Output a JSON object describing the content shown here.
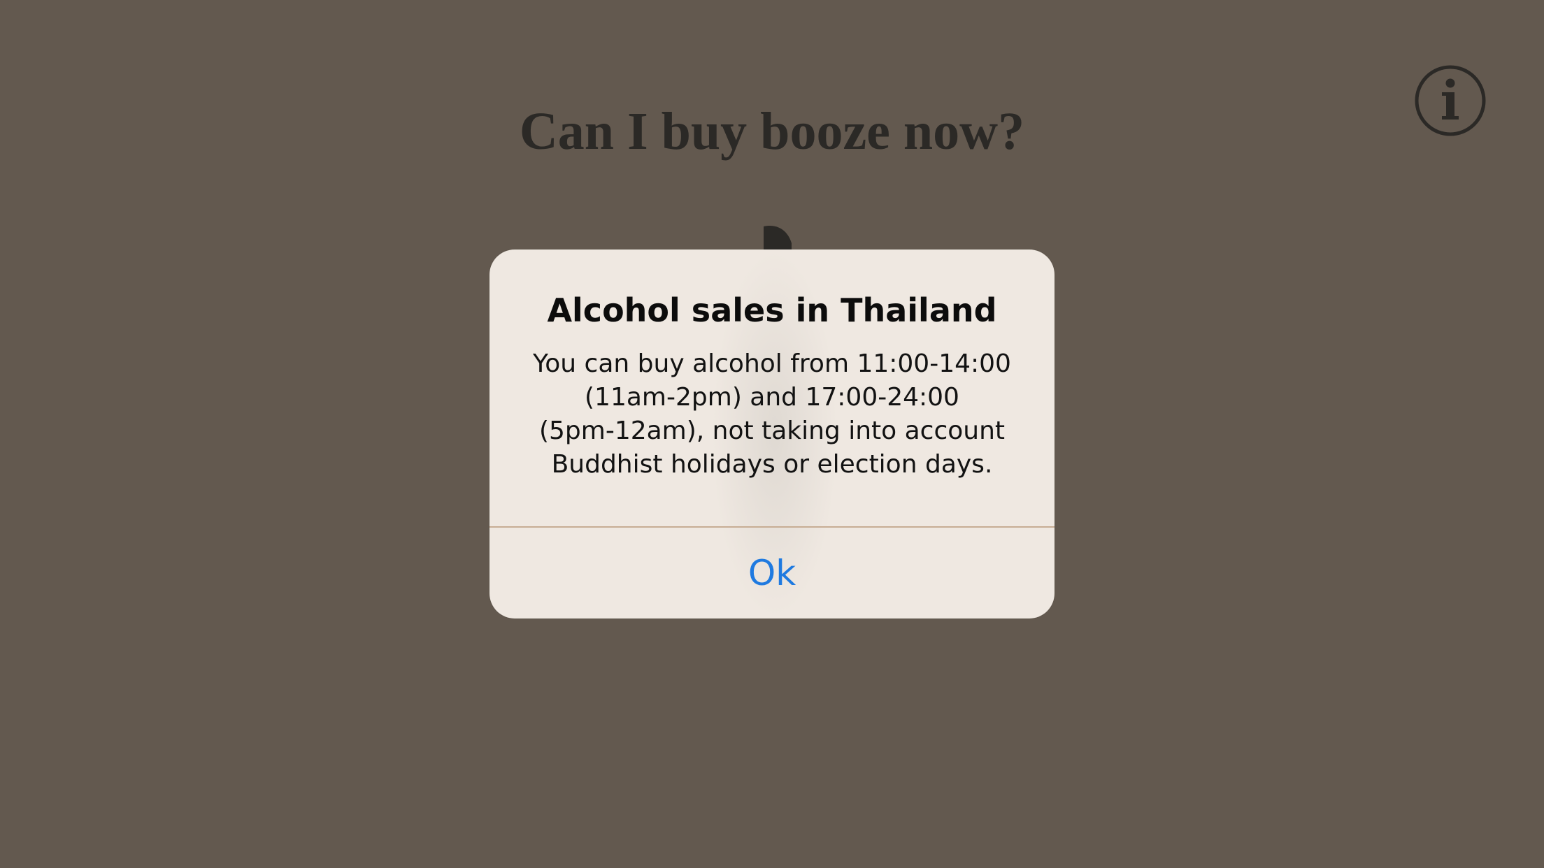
{
  "app": {
    "title": "Can I buy booze now?",
    "info_icon": "info-circle-icon"
  },
  "alert": {
    "title": "Alcohol sales in Thailand",
    "message_lines": [
      "You can buy alcohol from 11:00-14:00",
      "(11am-2pm) and 17:00-24:00",
      "(5pm-12am), not taking into account",
      "Buddhist holidays or election days."
    ],
    "button_label": "Ok"
  },
  "colors": {
    "background": "#63594f",
    "title_text": "#2b2926",
    "alert_background": "#efe8e1",
    "alert_divider": "#c7ad94",
    "button_accent": "#1f7ae0"
  }
}
